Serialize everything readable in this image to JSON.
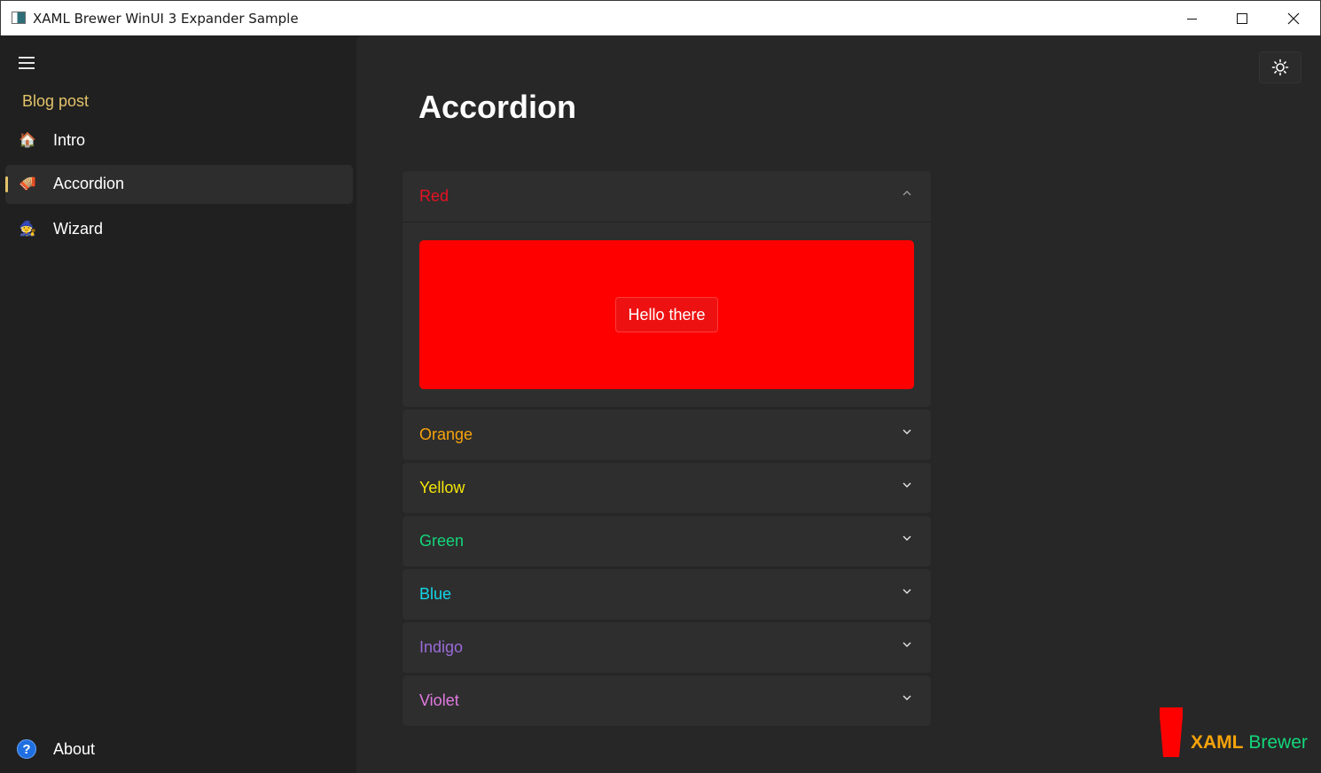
{
  "window": {
    "title": "XAML Brewer WinUI 3 Expander Sample"
  },
  "nav": {
    "header": "Blog post",
    "items": [
      {
        "label": "Intro",
        "icon": "house-icon",
        "glyph": "🏠"
      },
      {
        "label": "Accordion",
        "icon": "accordion-icon",
        "glyph": "🪗",
        "selected": true
      },
      {
        "label": "Wizard",
        "icon": "wizard-icon",
        "glyph": "🧙"
      }
    ],
    "about": {
      "label": "About",
      "icon": "question-icon",
      "glyph": "?"
    }
  },
  "page": {
    "title": "Accordion"
  },
  "theme_button": {
    "icon": "sun-icon",
    "glyph": "☼"
  },
  "expanders": [
    {
      "label": "Red",
      "color": "#e81123",
      "expanded": true,
      "content_color": "#ff0000",
      "button": "Hello there"
    },
    {
      "label": "Orange",
      "color": "#f7a30a",
      "expanded": false
    },
    {
      "label": "Yellow",
      "color": "#f5e60a",
      "expanded": false
    },
    {
      "label": "Green",
      "color": "#13d67a",
      "expanded": false
    },
    {
      "label": "Blue",
      "color": "#11d6e8",
      "expanded": false
    },
    {
      "label": "Indigo",
      "color": "#9a6bd8",
      "expanded": false
    },
    {
      "label": "Violet",
      "color": "#e07ae0",
      "expanded": false
    }
  ],
  "logo": {
    "word1": "XAML",
    "word2": "Brewer",
    "color1": "#f7a30a",
    "color2": "#13d67a",
    "cup_color": "#ff0000"
  }
}
